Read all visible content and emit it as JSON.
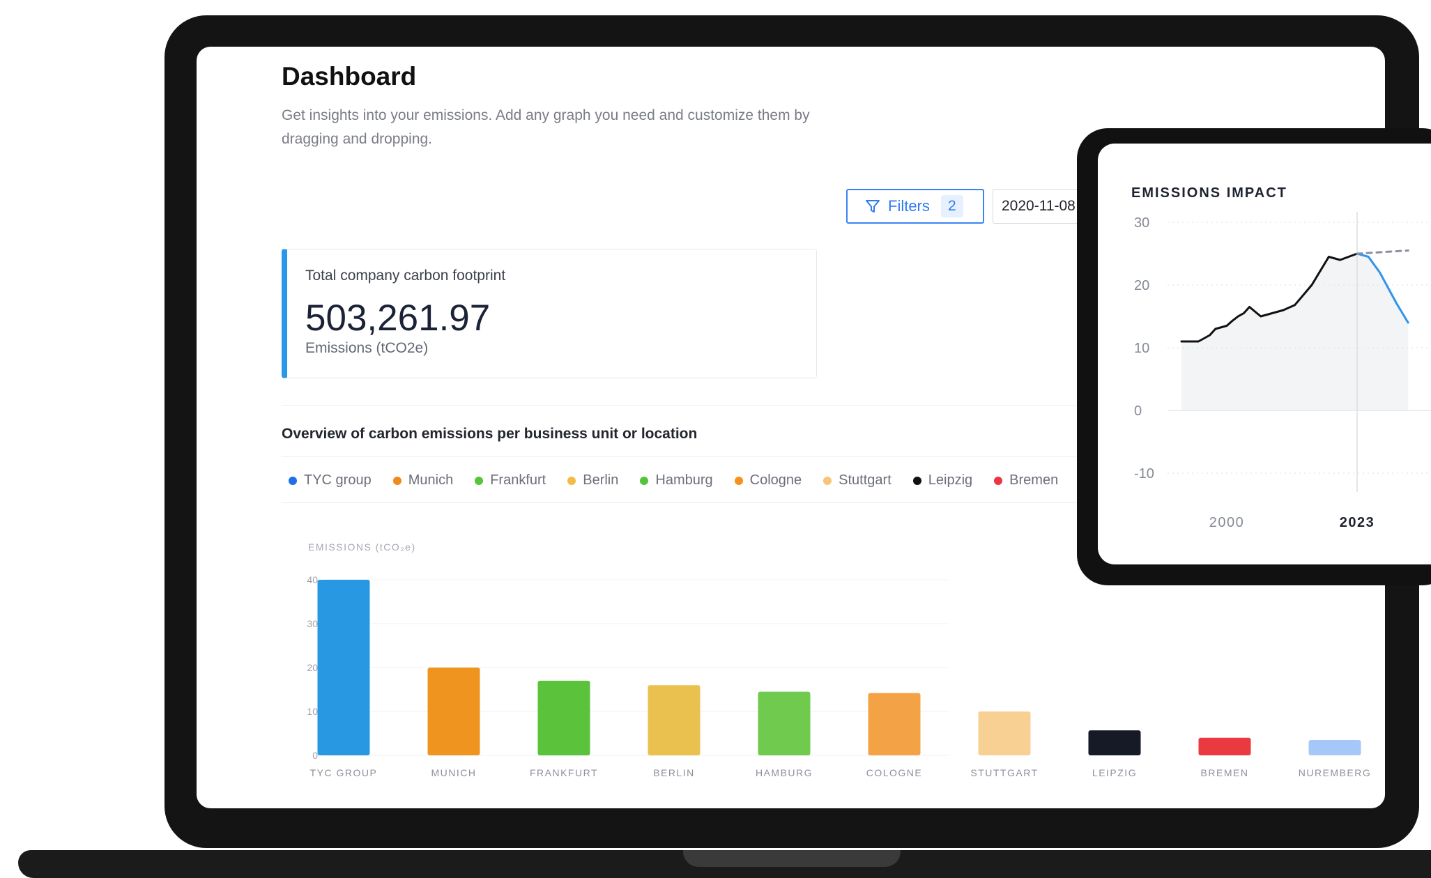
{
  "header": {
    "title": "Dashboard",
    "subtitle": "Get insights into your emissions. Add any graph you need and customize them by dragging and dropping."
  },
  "toolbar": {
    "filters_label": "Filters",
    "filters_count": "2",
    "date_value": "2020-11-08"
  },
  "kpi": {
    "label": "Total company carbon footprint",
    "value": "503,261.97",
    "unit": "Emissions (tCO2e)"
  },
  "overview": {
    "title": "Overview of carbon emissions per business unit or location",
    "legend": [
      {
        "label": "TYC group",
        "color": "#1f6fe8"
      },
      {
        "label": "Munich",
        "color": "#f08a1c"
      },
      {
        "label": "Frankfurt",
        "color": "#57c43a"
      },
      {
        "label": "Berlin",
        "color": "#f2bb44"
      },
      {
        "label": "Hamburg",
        "color": "#54c43a"
      },
      {
        "label": "Cologne",
        "color": "#f5921f"
      },
      {
        "label": "Stuttgart",
        "color": "#f8c478"
      },
      {
        "label": "Leipzig",
        "color": "#111111"
      },
      {
        "label": "Bremen",
        "color": "#ee3346"
      }
    ]
  },
  "chart_data": [
    {
      "type": "bar",
      "title": "",
      "ylabel": "EMISSIONS (tCO₂e)",
      "categories": [
        "TYC GROUP",
        "MUNICH",
        "FRANKFURT",
        "BERLIN",
        "HAMBURG",
        "COLOGNE",
        "STUTTGART",
        "LEIPZIG",
        "BREMEN",
        "NUREMBERG"
      ],
      "values": [
        40,
        20,
        17,
        16,
        14.5,
        14.2,
        10,
        5.7,
        4,
        3.5
      ],
      "colors": [
        "#2998e2",
        "#ef951f",
        "#5ac23b",
        "#eac04e",
        "#70ca4e",
        "#f3a345",
        "#f9d093",
        "#161a26",
        "#ea393f",
        "#a6c8f8"
      ],
      "ylim": [
        0,
        40
      ],
      "yticks": [
        0,
        10,
        20,
        30,
        40
      ],
      "grid": true
    },
    {
      "type": "line",
      "title": "EMISSIONS IMPACT",
      "ylim": [
        -10,
        30
      ],
      "yticks": [
        30,
        20,
        10,
        0,
        -10
      ],
      "xticks": [
        "2000",
        "2023"
      ],
      "highlight_tick": "2023",
      "series": [
        {
          "style": "historical",
          "color": "#111111",
          "x": [
            1992,
            1995,
            1997,
            1998,
            2000,
            2001,
            2002,
            2003,
            2004,
            2006,
            2008,
            2010,
            2012,
            2015,
            2018,
            2020,
            2023
          ],
          "y": [
            11,
            11,
            12,
            13,
            13.5,
            14.3,
            15,
            15.5,
            16.5,
            15,
            15.5,
            16,
            16.8,
            20,
            24.5,
            24,
            25
          ]
        },
        {
          "style": "forecast",
          "color": "#2f95ea",
          "x": [
            2023,
            2025,
            2027,
            2030,
            2032
          ],
          "y": [
            25,
            24.5,
            22,
            17,
            14
          ]
        },
        {
          "style": "target",
          "color": "#8a8fa0",
          "x": [
            2023,
            2032
          ],
          "y": [
            25,
            25.5
          ]
        }
      ]
    }
  ]
}
